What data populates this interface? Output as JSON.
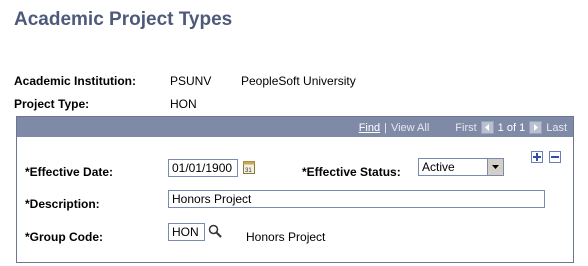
{
  "page": {
    "title": "Academic Project Types"
  },
  "header_fields": {
    "institution_label": "Academic Institution:",
    "institution_code": "PSUNV",
    "institution_name": "PeopleSoft University",
    "project_type_label": "Project Type:",
    "project_type_value": "HON"
  },
  "grid_nav": {
    "find": "Find",
    "separator": "|",
    "view_all": "View All",
    "first": "First",
    "count": "1 of 1",
    "last": "Last"
  },
  "form": {
    "effective_date_label": "*Effective Date:",
    "effective_date_value": "01/01/1900",
    "effective_status_label": "*Effective Status:",
    "effective_status_value": "Active",
    "description_label": "*Description:",
    "description_value": "Honors Project",
    "group_code_label": "*Group Code:",
    "group_code_value": "HON",
    "group_code_description": "Honors Project"
  },
  "icons": {
    "calendar": "calendar-icon",
    "lookup": "search-icon",
    "dropdown": "chevron-down-icon",
    "add_row": "plus-icon",
    "delete_row": "minus-icon",
    "prev": "chevron-left-icon",
    "next": "chevron-right-icon"
  },
  "colors": {
    "title": "#4d5a7a",
    "header_bar": "#7f8aa6",
    "input_border": "#7b8ab0"
  }
}
